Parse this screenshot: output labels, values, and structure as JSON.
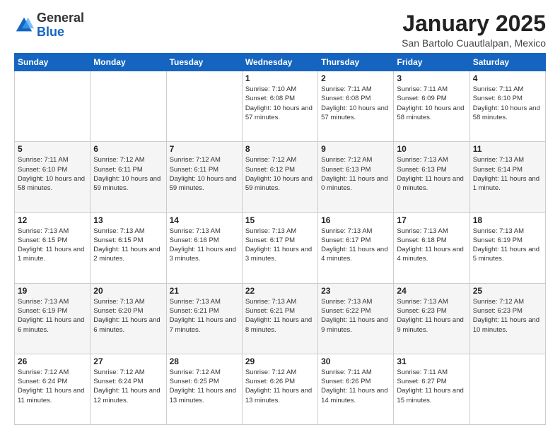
{
  "header": {
    "logo": {
      "general": "General",
      "blue": "Blue"
    },
    "title": "January 2025",
    "subtitle": "San Bartolo Cuautlalpan, Mexico"
  },
  "columns": [
    "Sunday",
    "Monday",
    "Tuesday",
    "Wednesday",
    "Thursday",
    "Friday",
    "Saturday"
  ],
  "weeks": [
    [
      {
        "day": "",
        "info": ""
      },
      {
        "day": "",
        "info": ""
      },
      {
        "day": "",
        "info": ""
      },
      {
        "day": "1",
        "info": "Sunrise: 7:10 AM\nSunset: 6:08 PM\nDaylight: 10 hours\nand 57 minutes."
      },
      {
        "day": "2",
        "info": "Sunrise: 7:11 AM\nSunset: 6:08 PM\nDaylight: 10 hours\nand 57 minutes."
      },
      {
        "day": "3",
        "info": "Sunrise: 7:11 AM\nSunset: 6:09 PM\nDaylight: 10 hours\nand 58 minutes."
      },
      {
        "day": "4",
        "info": "Sunrise: 7:11 AM\nSunset: 6:10 PM\nDaylight: 10 hours\nand 58 minutes."
      }
    ],
    [
      {
        "day": "5",
        "info": "Sunrise: 7:11 AM\nSunset: 6:10 PM\nDaylight: 10 hours\nand 58 minutes."
      },
      {
        "day": "6",
        "info": "Sunrise: 7:12 AM\nSunset: 6:11 PM\nDaylight: 10 hours\nand 59 minutes."
      },
      {
        "day": "7",
        "info": "Sunrise: 7:12 AM\nSunset: 6:11 PM\nDaylight: 10 hours\nand 59 minutes."
      },
      {
        "day": "8",
        "info": "Sunrise: 7:12 AM\nSunset: 6:12 PM\nDaylight: 10 hours\nand 59 minutes."
      },
      {
        "day": "9",
        "info": "Sunrise: 7:12 AM\nSunset: 6:13 PM\nDaylight: 11 hours\nand 0 minutes."
      },
      {
        "day": "10",
        "info": "Sunrise: 7:13 AM\nSunset: 6:13 PM\nDaylight: 11 hours\nand 0 minutes."
      },
      {
        "day": "11",
        "info": "Sunrise: 7:13 AM\nSunset: 6:14 PM\nDaylight: 11 hours\nand 1 minute."
      }
    ],
    [
      {
        "day": "12",
        "info": "Sunrise: 7:13 AM\nSunset: 6:15 PM\nDaylight: 11 hours\nand 1 minute."
      },
      {
        "day": "13",
        "info": "Sunrise: 7:13 AM\nSunset: 6:15 PM\nDaylight: 11 hours\nand 2 minutes."
      },
      {
        "day": "14",
        "info": "Sunrise: 7:13 AM\nSunset: 6:16 PM\nDaylight: 11 hours\nand 3 minutes."
      },
      {
        "day": "15",
        "info": "Sunrise: 7:13 AM\nSunset: 6:17 PM\nDaylight: 11 hours\nand 3 minutes."
      },
      {
        "day": "16",
        "info": "Sunrise: 7:13 AM\nSunset: 6:17 PM\nDaylight: 11 hours\nand 4 minutes."
      },
      {
        "day": "17",
        "info": "Sunrise: 7:13 AM\nSunset: 6:18 PM\nDaylight: 11 hours\nand 4 minutes."
      },
      {
        "day": "18",
        "info": "Sunrise: 7:13 AM\nSunset: 6:19 PM\nDaylight: 11 hours\nand 5 minutes."
      }
    ],
    [
      {
        "day": "19",
        "info": "Sunrise: 7:13 AM\nSunset: 6:19 PM\nDaylight: 11 hours\nand 6 minutes."
      },
      {
        "day": "20",
        "info": "Sunrise: 7:13 AM\nSunset: 6:20 PM\nDaylight: 11 hours\nand 6 minutes."
      },
      {
        "day": "21",
        "info": "Sunrise: 7:13 AM\nSunset: 6:21 PM\nDaylight: 11 hours\nand 7 minutes."
      },
      {
        "day": "22",
        "info": "Sunrise: 7:13 AM\nSunset: 6:21 PM\nDaylight: 11 hours\nand 8 minutes."
      },
      {
        "day": "23",
        "info": "Sunrise: 7:13 AM\nSunset: 6:22 PM\nDaylight: 11 hours\nand 9 minutes."
      },
      {
        "day": "24",
        "info": "Sunrise: 7:13 AM\nSunset: 6:23 PM\nDaylight: 11 hours\nand 9 minutes."
      },
      {
        "day": "25",
        "info": "Sunrise: 7:12 AM\nSunset: 6:23 PM\nDaylight: 11 hours\nand 10 minutes."
      }
    ],
    [
      {
        "day": "26",
        "info": "Sunrise: 7:12 AM\nSunset: 6:24 PM\nDaylight: 11 hours\nand 11 minutes."
      },
      {
        "day": "27",
        "info": "Sunrise: 7:12 AM\nSunset: 6:24 PM\nDaylight: 11 hours\nand 12 minutes."
      },
      {
        "day": "28",
        "info": "Sunrise: 7:12 AM\nSunset: 6:25 PM\nDaylight: 11 hours\nand 13 minutes."
      },
      {
        "day": "29",
        "info": "Sunrise: 7:12 AM\nSunset: 6:26 PM\nDaylight: 11 hours\nand 13 minutes."
      },
      {
        "day": "30",
        "info": "Sunrise: 7:11 AM\nSunset: 6:26 PM\nDaylight: 11 hours\nand 14 minutes."
      },
      {
        "day": "31",
        "info": "Sunrise: 7:11 AM\nSunset: 6:27 PM\nDaylight: 11 hours\nand 15 minutes."
      },
      {
        "day": "",
        "info": ""
      }
    ]
  ]
}
